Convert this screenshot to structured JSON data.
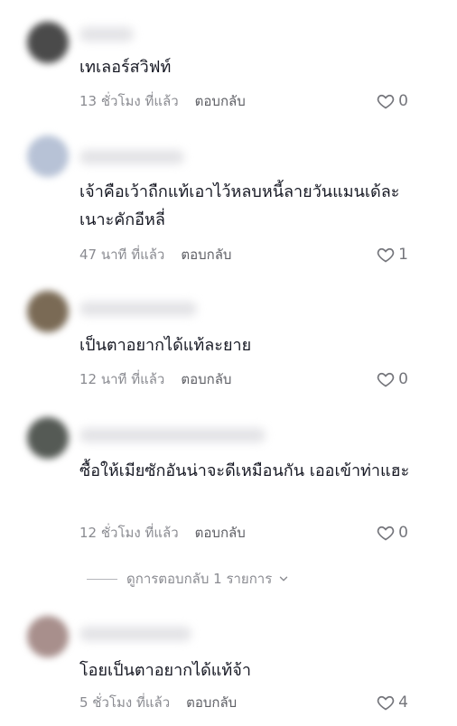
{
  "comments": [
    {
      "text": "เทเลอร์สวิฟท์",
      "time": "13 ชั่วโมง ที่แล้ว",
      "reply": "ตอบกลับ",
      "likes": "0",
      "avatar_color": "#4a4a4a"
    },
    {
      "text": "เจ้าคือเว้าถืกแท้เอาไว้หลบหนี้ลายวันแมนเด้ละเนาะคักอีหลี่",
      "time": "47 นาที ที่แล้ว",
      "reply": "ตอบกลับ",
      "likes": "1",
      "avatar_color": "#b7c2d6"
    },
    {
      "text": "เป็นตาอยากได้แท้ละยาย",
      "time": "12 นาที ที่แล้ว",
      "reply": "ตอบกลับ",
      "likes": "0",
      "avatar_color": "#7a6a55"
    },
    {
      "text": "ซื้อให้เมียซักอันน่าจะดีเหมือนกัน เออเข้าท่าแฮะ",
      "time": "12 ชั่วโมง ที่แล้ว",
      "reply": "ตอบกลับ",
      "likes": "0",
      "avatar_color": "#555a55"
    },
    {
      "text": "โอยเป็นตาอยากได้แท้จ้า",
      "time": "5 ชั่วโมง ที่แล้ว",
      "reply": "ตอบกลับ",
      "likes": "4",
      "avatar_color": "#a88f8c"
    }
  ],
  "view_replies": {
    "label": "ดูการตอบกลับ 1 รายการ"
  }
}
